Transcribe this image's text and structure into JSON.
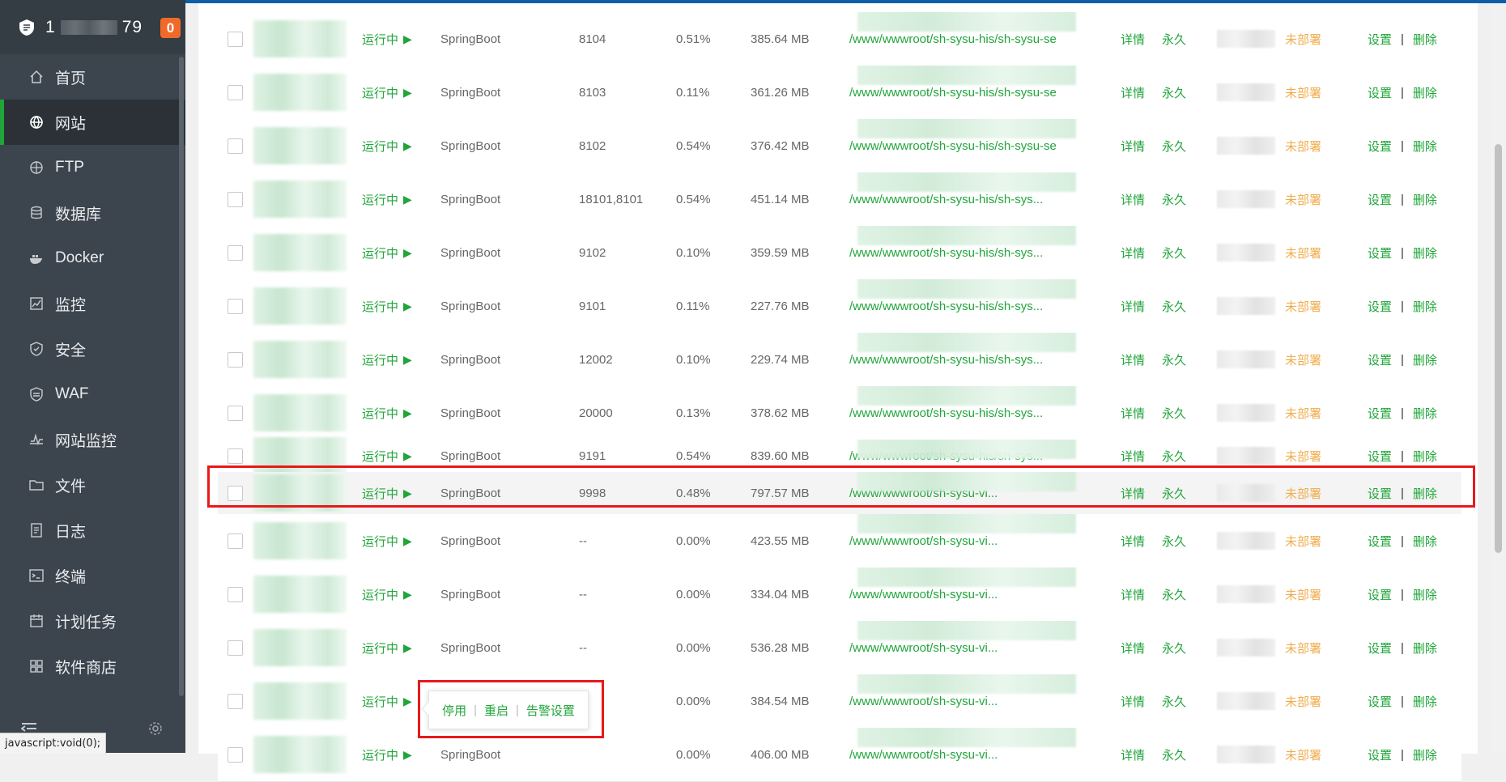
{
  "sidebar": {
    "account_prefix": "1",
    "account_suffix": "79",
    "badge": "0",
    "items": [
      {
        "label": "首页",
        "icon": "home-icon"
      },
      {
        "label": "网站",
        "icon": "globe-icon",
        "active": true
      },
      {
        "label": "FTP",
        "icon": "ftp-globe-icon"
      },
      {
        "label": "数据库",
        "icon": "database-icon"
      },
      {
        "label": "Docker",
        "icon": "docker-icon"
      },
      {
        "label": "监控",
        "icon": "monitor-chart-icon"
      },
      {
        "label": "安全",
        "icon": "shield-icon"
      },
      {
        "label": "WAF",
        "icon": "waf-shield-icon"
      },
      {
        "label": "网站监控",
        "icon": "pulse-icon"
      },
      {
        "label": "文件",
        "icon": "folder-icon"
      },
      {
        "label": "日志",
        "icon": "log-icon"
      },
      {
        "label": "终端",
        "icon": "terminal-icon"
      },
      {
        "label": "计划任务",
        "icon": "calendar-icon"
      },
      {
        "label": "软件商店",
        "icon": "apps-icon"
      }
    ]
  },
  "status_bar": "javascript:void(0);",
  "row_common": {
    "status": "运行中",
    "type": "SpringBoot",
    "detail": "详情",
    "expire": "永久",
    "ssl": "未部署",
    "settings": "设置",
    "divider": "|",
    "delete": "删除"
  },
  "rows": [
    {
      "port": "8104",
      "cpu": "0.51%",
      "mem": "385.64 MB",
      "path": "/www/wwwroot/sh-sysu-his/sh-sysu-se"
    },
    {
      "port": "8103",
      "cpu": "0.11%",
      "mem": "361.26 MB",
      "path": "/www/wwwroot/sh-sysu-his/sh-sysu-se"
    },
    {
      "port": "8102",
      "cpu": "0.54%",
      "mem": "376.42 MB",
      "path": "/www/wwwroot/sh-sysu-his/sh-sysu-se"
    },
    {
      "port": "18101,8101",
      "cpu": "0.54%",
      "mem": "451.14 MB",
      "path": "/www/wwwroot/sh-sysu-his/sh-sys..."
    },
    {
      "port": "9102",
      "cpu": "0.10%",
      "mem": "359.59 MB",
      "path": "/www/wwwroot/sh-sysu-his/sh-sys..."
    },
    {
      "port": "9101",
      "cpu": "0.11%",
      "mem": "227.76 MB",
      "path": "/www/wwwroot/sh-sysu-his/sh-sys..."
    },
    {
      "port": "12002",
      "cpu": "0.10%",
      "mem": "229.74 MB",
      "path": "/www/wwwroot/sh-sysu-his/sh-sys..."
    },
    {
      "port": "20000",
      "cpu": "0.13%",
      "mem": "378.62 MB",
      "path": "/www/wwwroot/sh-sysu-his/sh-sys..."
    },
    {
      "port": "9191",
      "cpu": "0.54%",
      "mem": "839.60 MB",
      "path": "/www/wwwroot/sh-sysu-his/sh-sys..."
    },
    {
      "port": "9998",
      "cpu": "0.48%",
      "mem": "797.57 MB",
      "path": "/www/wwwroot/sh-sysu-vi..."
    },
    {
      "port": "--",
      "cpu": "0.00%",
      "mem": "423.55 MB",
      "path": "/www/wwwroot/sh-sysu-vi..."
    },
    {
      "port": "--",
      "cpu": "0.00%",
      "mem": "334.04 MB",
      "path": "/www/wwwroot/sh-sysu-vi..."
    },
    {
      "port": "--",
      "cpu": "0.00%",
      "mem": "536.28 MB",
      "path": "/www/wwwroot/sh-sysu-vi..."
    },
    {
      "port": "--",
      "cpu": "0.00%",
      "mem": "384.54 MB",
      "path": "/www/wwwroot/sh-sysu-vi..."
    },
    {
      "port": "",
      "cpu": "0.00%",
      "mem": "406.00 MB",
      "path": "/www/wwwroot/sh-sysu-vi..."
    }
  ],
  "popup": {
    "stop": "停用",
    "restart": "重启",
    "alert": "告警设置",
    "divider": "|"
  }
}
